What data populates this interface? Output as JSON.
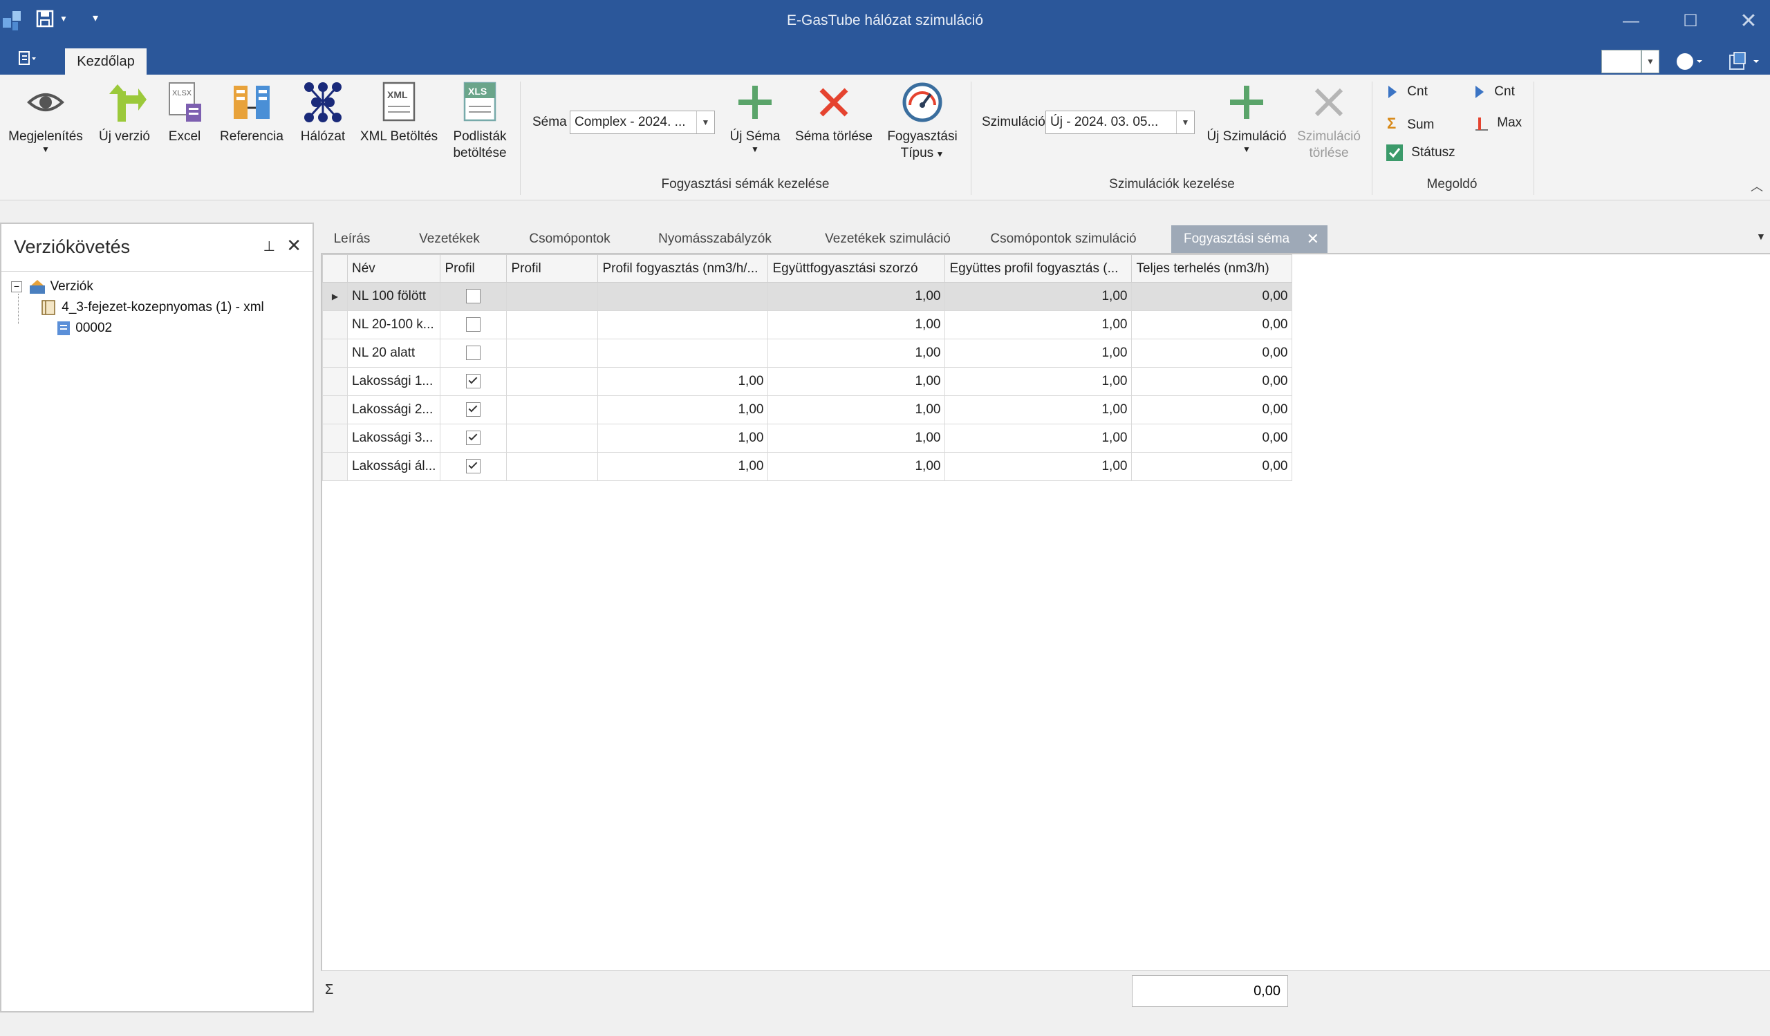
{
  "app": {
    "title": "E-GasTube hálózat szimuláció"
  },
  "ribbon": {
    "tab_home": "Kezdőlap",
    "buttons": {
      "megjelenites": "Megjelenítés",
      "uj_verzio": "Új verzió",
      "excel": "Excel",
      "referencia": "Referencia",
      "halozat": "Hálózat",
      "xml_betoltes": "XML Betöltés",
      "podlistak_1": "Podlisták",
      "podlistak_2": "betöltése",
      "uj_sema": "Új Séma",
      "sema_torlese": "Séma törlése",
      "fogy_tipus_1": "Fogyasztási",
      "fogy_tipus_2": "Típus",
      "uj_szimulacio": "Új Szimuláció",
      "szim_torlese_1": "Szimuláció",
      "szim_torlese_2": "törlése"
    },
    "icon_texts": {
      "xlsx": "XLSX",
      "xml": "XML",
      "xls": "XLS"
    },
    "sema_label": "Séma",
    "sema_value": "Complex - 2024. ...",
    "szimulacio_label": "Szimuláció",
    "szimulacio_value": "Új - 2024. 03. 05...",
    "groups": {
      "fogyasztasi": "Fogyasztási sémák kezelése",
      "szimulaciok": "Szimulációk kezelése",
      "megoldo": "Megoldó"
    },
    "megoldo_items": {
      "cnt1": "Cnt",
      "sum": "Sum",
      "statusz": "Státusz",
      "cnt2": "Cnt",
      "max": "Max"
    }
  },
  "left_panel": {
    "title": "Verziókövetés",
    "tree": {
      "root": "Verziók",
      "child1": "4_3-fejezet-kozepnyomas (1) - xml",
      "child2": "00002"
    }
  },
  "doc_tabs": [
    "Leírás",
    "Vezetékek",
    "Csomópontok",
    "Nyomásszabályzók",
    "Vezetékek szimuláció",
    "Csomópontok szimuláció",
    "Fogyasztási séma"
  ],
  "grid": {
    "columns": [
      "Név",
      "Profil",
      "Profil",
      "Profil fogyasztás (nm3/h/...",
      "Együttfogyasztási szorzó",
      "Együttes profil fogyasztás (...",
      "Teljes terhelés (nm3/h)"
    ],
    "rows": [
      {
        "nev": "NL 100 fölött",
        "profil_checked": false,
        "profil2": "",
        "profil_fogy": "",
        "szorzo": "1,00",
        "egyuttes": "1,00",
        "terheles": "0,00"
      },
      {
        "nev": "NL 20-100 k...",
        "profil_checked": false,
        "profil2": "",
        "profil_fogy": "",
        "szorzo": "1,00",
        "egyuttes": "1,00",
        "terheles": "0,00"
      },
      {
        "nev": "NL 20 alatt",
        "profil_checked": false,
        "profil2": "",
        "profil_fogy": "",
        "szorzo": "1,00",
        "egyuttes": "1,00",
        "terheles": "0,00"
      },
      {
        "nev": "Lakossági 1...",
        "profil_checked": true,
        "profil2": "",
        "profil_fogy": "1,00",
        "szorzo": "1,00",
        "egyuttes": "1,00",
        "terheles": "0,00"
      },
      {
        "nev": "Lakossági 2...",
        "profil_checked": true,
        "profil2": "",
        "profil_fogy": "1,00",
        "szorzo": "1,00",
        "egyuttes": "1,00",
        "terheles": "0,00"
      },
      {
        "nev": "Lakossági 3...",
        "profil_checked": true,
        "profil2": "",
        "profil_fogy": "1,00",
        "szorzo": "1,00",
        "egyuttes": "1,00",
        "terheles": "0,00"
      },
      {
        "nev": "Lakossági ál...",
        "profil_checked": true,
        "profil2": "",
        "profil_fogy": "1,00",
        "szorzo": "1,00",
        "egyuttes": "1,00",
        "terheles": "0,00"
      }
    ],
    "footer_sigma": "Σ",
    "footer_total": "0,00"
  },
  "colors": {
    "titlebar": "#2b579a",
    "accent_green": "#5aa46a",
    "accent_red": "#e5432f"
  }
}
